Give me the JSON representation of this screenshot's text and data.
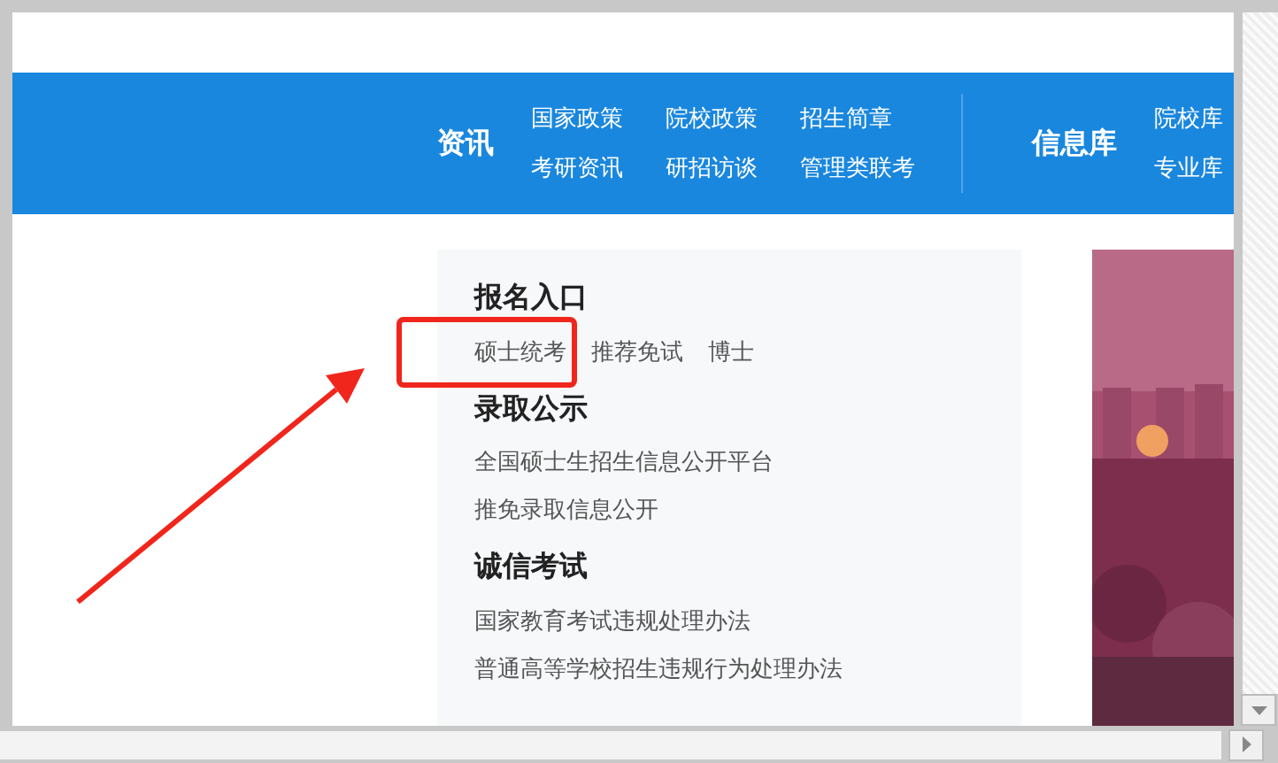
{
  "nav": {
    "sections": [
      {
        "title": "资讯",
        "links": [
          "国家政策",
          "院校政策",
          "招生简章",
          "考研资讯",
          "研招访谈",
          "管理类联考"
        ]
      },
      {
        "title": "信息库",
        "links": [
          "院校库",
          "专业库"
        ]
      }
    ]
  },
  "panel": {
    "groups": [
      {
        "heading": "报名入口",
        "kind": "inline",
        "links": [
          {
            "text": "硕士统考",
            "highlighted": true
          },
          {
            "text": "推荐免试",
            "highlighted": false
          },
          {
            "text": "博士",
            "highlighted": false
          }
        ]
      },
      {
        "heading": "录取公示",
        "kind": "list",
        "links": [
          {
            "text": "全国硕士生招生信息公开平台",
            "highlighted": false
          },
          {
            "text": "推免录取信息公开",
            "highlighted": false
          }
        ]
      },
      {
        "heading": "诚信考试",
        "kind": "list",
        "links": [
          {
            "text": "国家教育考试违规处理办法",
            "highlighted": false
          },
          {
            "text": "普通高等学校招生违规行为处理办法",
            "highlighted": false
          }
        ]
      }
    ]
  }
}
